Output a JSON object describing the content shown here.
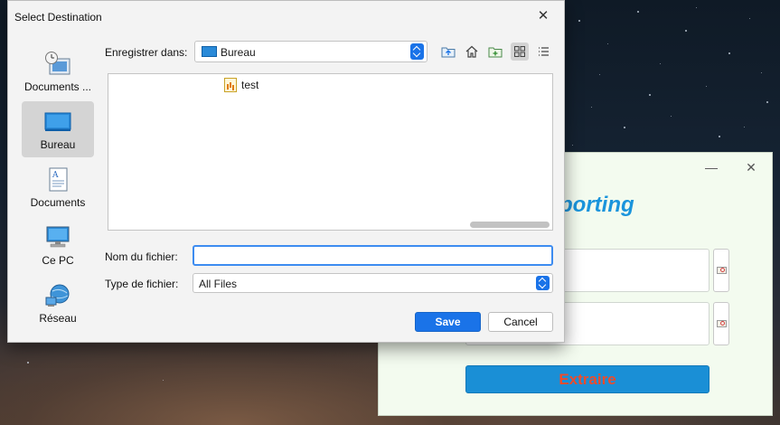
{
  "dialog": {
    "title": "Select Destination",
    "places": [
      {
        "label": "Documents ...",
        "icon": "recent-documents-icon"
      },
      {
        "label": "Bureau",
        "icon": "desktop-icon",
        "active": true
      },
      {
        "label": "Documents",
        "icon": "documents-icon"
      },
      {
        "label": "Ce PC",
        "icon": "computer-icon"
      },
      {
        "label": "Réseau",
        "icon": "network-icon"
      }
    ],
    "look_in_label": "Enregistrer dans:",
    "look_in_value": "Bureau",
    "toolbar": [
      "up-folder-icon",
      "home-icon",
      "new-folder-icon",
      "icon-view-icon",
      "list-view-icon"
    ],
    "files": [
      {
        "name": "test",
        "icon": "spreadsheet-file-icon"
      }
    ],
    "filename_label": "Nom du fichier:",
    "filename_value": "",
    "filetype_label": "Type de fichier:",
    "filetype_value": "All Files",
    "save_label": "Save",
    "cancel_label": "Cancel"
  },
  "background_app": {
    "heading": "porting",
    "extract_label": "Extraire",
    "accent": "#1a8fd6",
    "extract_text_color": "#ef4b2a"
  },
  "colors": {
    "primary_button": "#1a73e8",
    "focus_border": "#3d8cf0"
  }
}
